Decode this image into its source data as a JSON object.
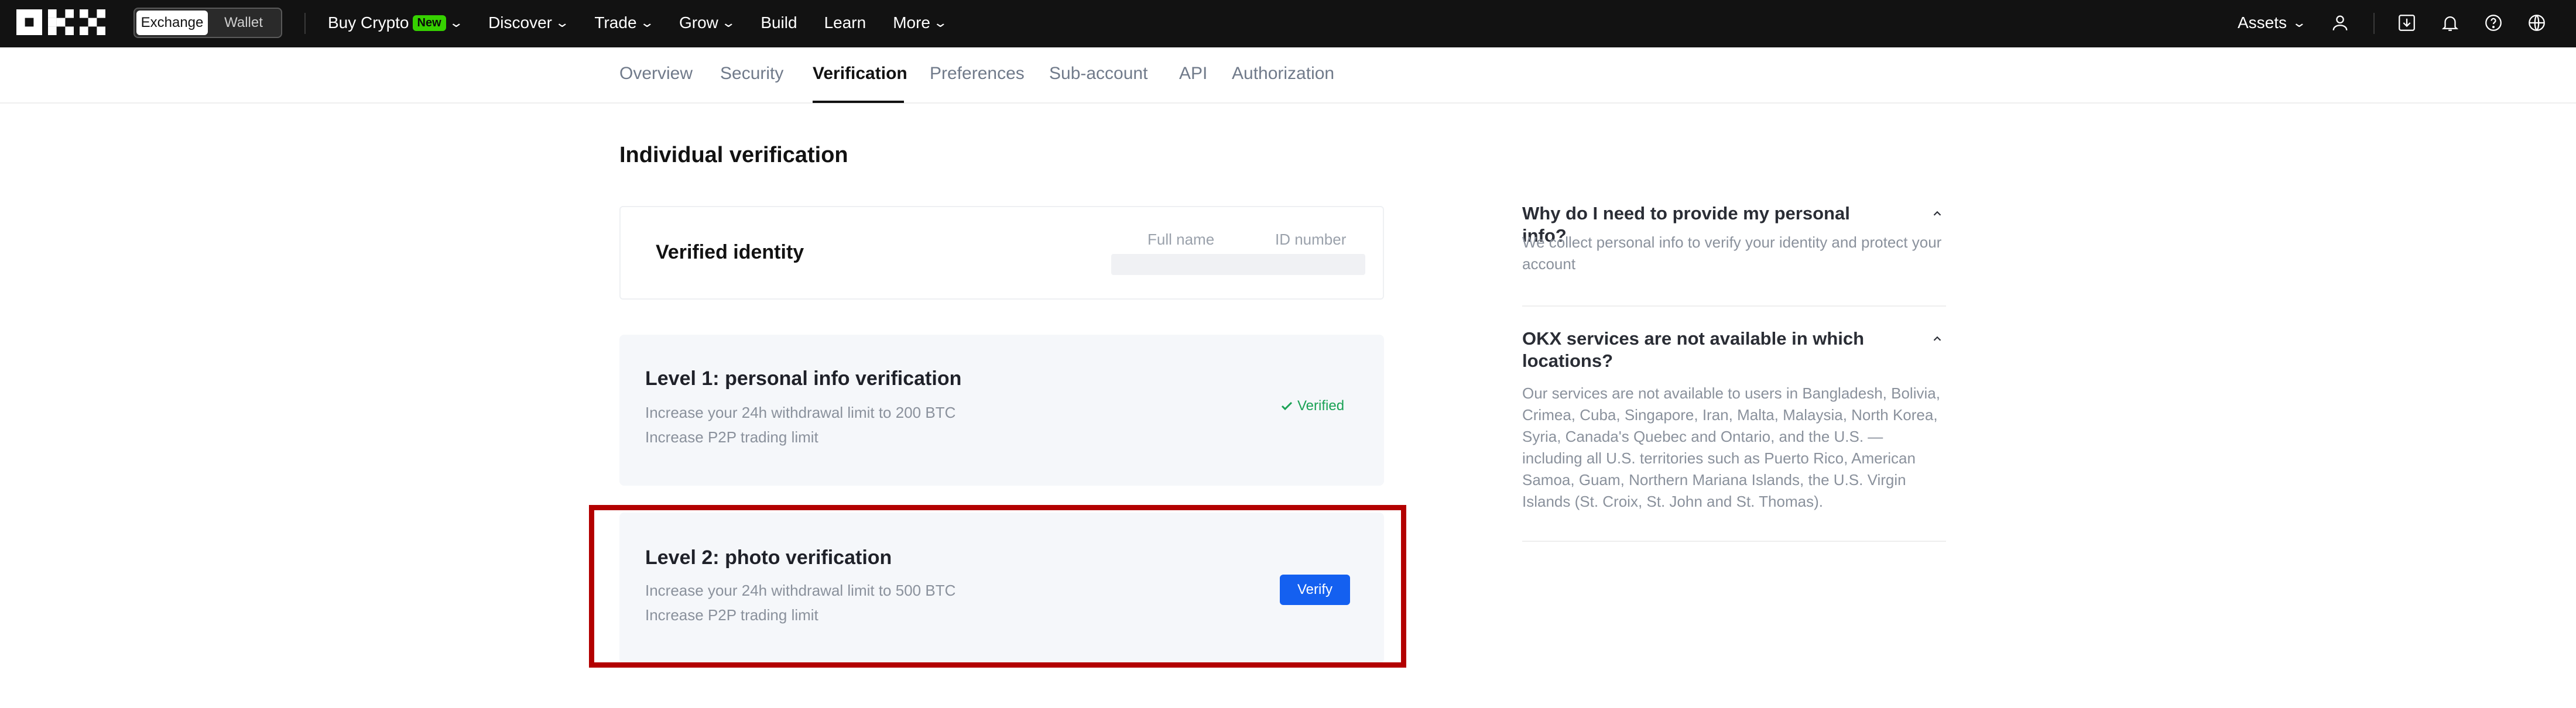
{
  "app": {
    "brand": "OKX",
    "mode_toggle": {
      "options": [
        "Exchange",
        "Wallet"
      ],
      "active": "Exchange"
    },
    "nav": {
      "buy_crypto": "Buy Crypto",
      "new_badge": "New",
      "discover": "Discover",
      "trade": "Trade",
      "grow": "Grow",
      "build": "Build",
      "learn": "Learn",
      "more": "More",
      "assets": "Assets"
    },
    "nav_icons": [
      "user-icon",
      "download-icon",
      "bell-icon",
      "help-icon",
      "globe-icon"
    ]
  },
  "tabs": {
    "items": [
      "Overview",
      "Security",
      "Verification",
      "Preferences",
      "Sub-account",
      "API",
      "Authorization"
    ],
    "active": "Verification"
  },
  "page": {
    "title": "Individual verification",
    "identity": {
      "title": "Verified identity",
      "col_full_name": "Full name",
      "col_id_number": "ID number"
    },
    "levels": [
      {
        "title": "Level 1: personal info verification",
        "desc1": "Increase your 24h withdrawal limit to 200 BTC",
        "desc2": "Increase P2P trading limit",
        "status": "Verified"
      },
      {
        "title": "Level 2: photo verification",
        "desc1": "Increase your 24h withdrawal limit to 500 BTC",
        "desc2": "Increase P2P trading limit",
        "action": "Verify"
      }
    ]
  },
  "faq": [
    {
      "q": "Why do I need to provide my personal info?",
      "a": "We collect personal info to verify your identity and protect your account"
    },
    {
      "q": "OKX services are not available in which locations?",
      "a": "Our services are not available to users in Bangladesh, Bolivia, Crimea, Cuba, Singapore, Iran, Malta, Malaysia, North Korea, Syria, Canada's Quebec and Ontario, and the U.S. — including all U.S. territories such as Puerto Rico, American Samoa, Guam, Northern Mariana Islands, the U.S. Virgin Islands (St. Croix, St. John and St. Thomas)."
    }
  ],
  "colors": {
    "nav_bg": "#121212",
    "accent_blue": "#1460f0",
    "verified_green": "#1aa255",
    "new_badge": "#36d100",
    "highlight_red": "#b30000"
  }
}
